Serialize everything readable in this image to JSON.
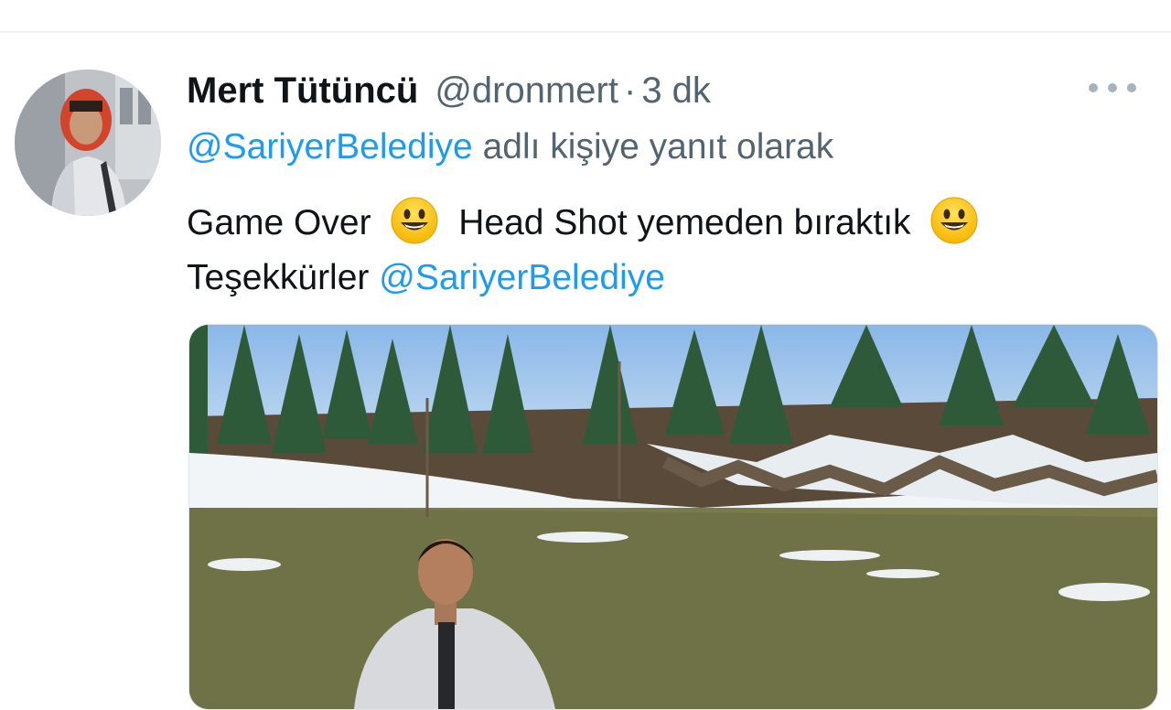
{
  "tweet": {
    "author_name": "Mert Tütüncü",
    "handle": "@dronmert",
    "separator": "·",
    "time": "3 dk",
    "reply_to_mention": "@SariyerBelediye",
    "reply_to_text": " adlı kişiye yanıt olarak",
    "line1_part1": "Game Over",
    "line1_part2": "Head Shot yemeden bıraktık",
    "line2_text": "Teşekkürler ",
    "line2_mention": "@SariyerBelediye"
  },
  "icons": {
    "more": "more-horizontal-icon",
    "emoji": "smiley-face-emoji"
  },
  "colors": {
    "link": "#1d9bf0",
    "secondary_text": "#536471",
    "primary_text": "#0f1419"
  }
}
